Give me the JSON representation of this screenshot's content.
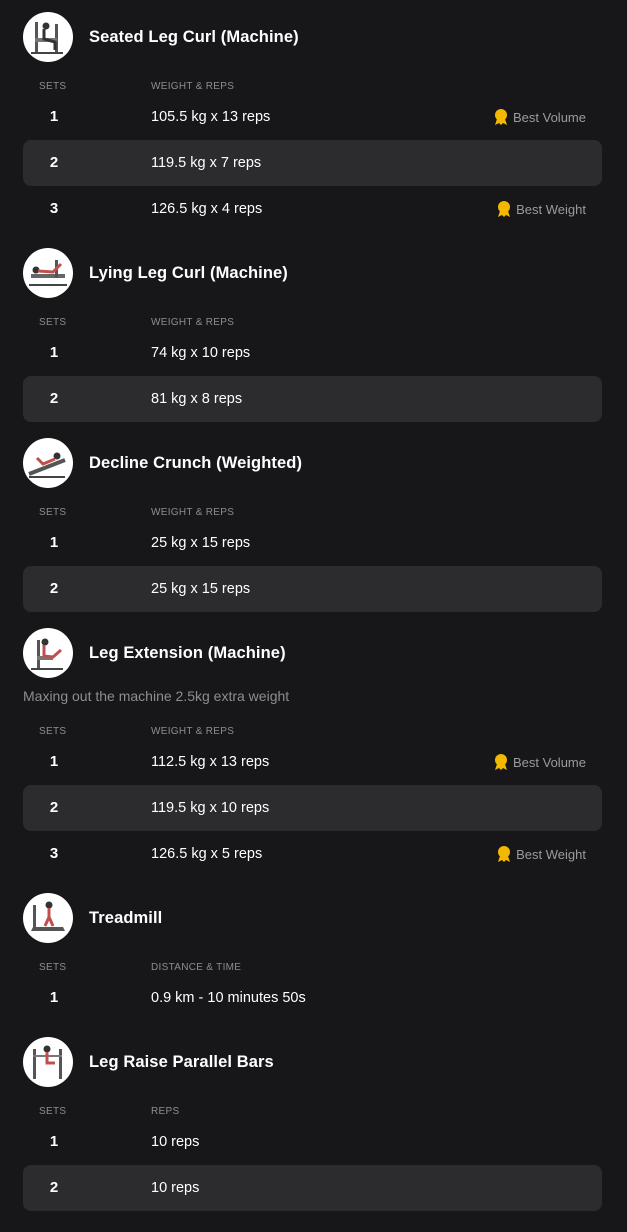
{
  "icons": {
    "medal": "medal-icon",
    "medal_color": "#f5b800"
  },
  "exercises": [
    {
      "title": "Seated Leg Curl (Machine)",
      "thumb_icon": "seated-leg-curl-icon",
      "note": "",
      "col_sets": "SETS",
      "col_value": "WEIGHT & REPS",
      "sets": [
        {
          "num": "1",
          "value": "105.5 kg x 13 reps",
          "badge": "Best Volume"
        },
        {
          "num": "2",
          "value": "119.5 kg x 7 reps",
          "badge": ""
        },
        {
          "num": "3",
          "value": "126.5 kg x 4 reps",
          "badge": "Best Weight"
        }
      ]
    },
    {
      "title": "Lying Leg Curl (Machine)",
      "thumb_icon": "lying-leg-curl-icon",
      "note": "",
      "col_sets": "SETS",
      "col_value": "WEIGHT & REPS",
      "sets": [
        {
          "num": "1",
          "value": "74 kg x 10 reps",
          "badge": ""
        },
        {
          "num": "2",
          "value": "81 kg x 8 reps",
          "badge": ""
        }
      ]
    },
    {
      "title": "Decline Crunch (Weighted)",
      "thumb_icon": "decline-crunch-icon",
      "note": "",
      "col_sets": "SETS",
      "col_value": "WEIGHT & REPS",
      "sets": [
        {
          "num": "1",
          "value": "25 kg x 15 reps",
          "badge": ""
        },
        {
          "num": "2",
          "value": "25 kg x 15 reps",
          "badge": ""
        }
      ]
    },
    {
      "title": "Leg Extension (Machine)",
      "thumb_icon": "leg-extension-icon",
      "note": "Maxing out the machine 2.5kg extra weight",
      "col_sets": "SETS",
      "col_value": "WEIGHT & REPS",
      "sets": [
        {
          "num": "1",
          "value": "112.5 kg x 13 reps",
          "badge": "Best Volume"
        },
        {
          "num": "2",
          "value": "119.5 kg x 10 reps",
          "badge": ""
        },
        {
          "num": "3",
          "value": "126.5 kg x 5 reps",
          "badge": "Best Weight"
        }
      ]
    },
    {
      "title": "Treadmill",
      "thumb_icon": "treadmill-icon",
      "note": "",
      "col_sets": "SETS",
      "col_value": "DISTANCE & TIME",
      "sets": [
        {
          "num": "1",
          "value": "0.9 km - 10 minutes 50s",
          "badge": ""
        }
      ]
    },
    {
      "title": "Leg Raise Parallel Bars",
      "thumb_icon": "leg-raise-parallel-bars-icon",
      "note": "",
      "col_sets": "SETS",
      "col_value": "REPS",
      "sets": [
        {
          "num": "1",
          "value": "10 reps",
          "badge": ""
        },
        {
          "num": "2",
          "value": "10 reps",
          "badge": ""
        }
      ]
    }
  ]
}
